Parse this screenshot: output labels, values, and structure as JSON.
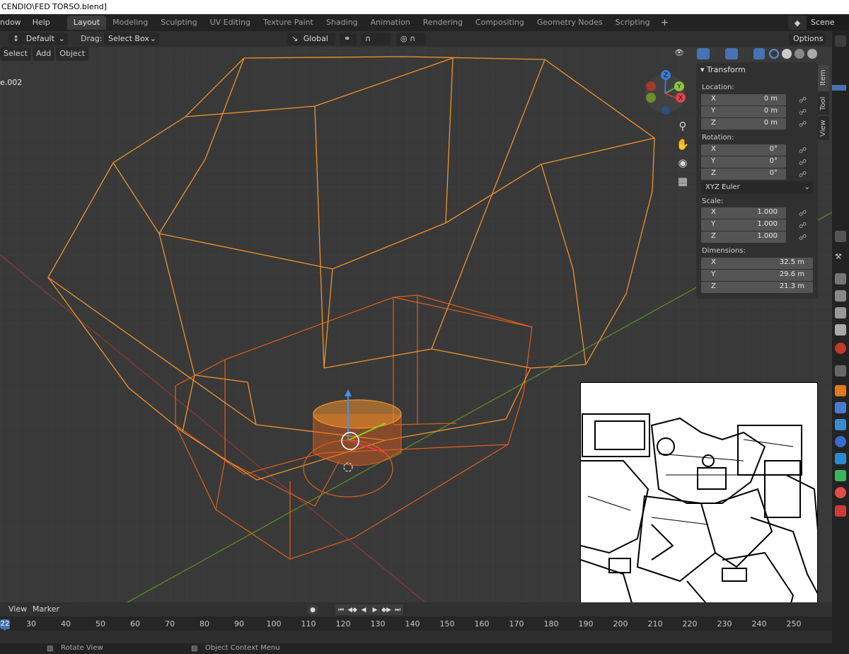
{
  "window": {
    "title": "CENDIO\\FED TORSO.blend]"
  },
  "menubar": {
    "items": [
      "ndow",
      "Help"
    ],
    "tabs": [
      "Layout",
      "Modeling",
      "Sculpting",
      "UV Editing",
      "Texture Paint",
      "Shading",
      "Animation",
      "Rendering",
      "Compositing",
      "Geometry Nodes",
      "Scripting"
    ],
    "add_tab": "+",
    "scene": "Scene"
  },
  "header": {
    "mode": "Default",
    "drag_label": "Drag:",
    "drag_value": "Select Box",
    "orientation": "Global",
    "options": "Options"
  },
  "viewport": {
    "menu": [
      "Select",
      "Add",
      "Object"
    ],
    "object_label": "e.002",
    "gizmo_axes": [
      "Z",
      "Y",
      "X"
    ]
  },
  "npanel": {
    "title": "Transform",
    "location_label": "Location:",
    "location": [
      {
        "axis": "X",
        "value": "0 m"
      },
      {
        "axis": "Y",
        "value": "0 m"
      },
      {
        "axis": "Z",
        "value": "0 m"
      }
    ],
    "rotation_label": "Rotation:",
    "rotation": [
      {
        "axis": "X",
        "value": "0°"
      },
      {
        "axis": "Y",
        "value": "0°"
      },
      {
        "axis": "Z",
        "value": "0°"
      }
    ],
    "rotation_mode": "XYZ Euler",
    "scale_label": "Scale:",
    "scale": [
      {
        "axis": "X",
        "value": "1.000"
      },
      {
        "axis": "Y",
        "value": "1.000"
      },
      {
        "axis": "Z",
        "value": "1.000"
      }
    ],
    "dimensions_label": "Dimensions:",
    "dimensions": [
      {
        "axis": "X",
        "value": "32.5 m"
      },
      {
        "axis": "Y",
        "value": "29.6 m"
      },
      {
        "axis": "Z",
        "value": "21.3 m"
      }
    ],
    "tabs": [
      "Item",
      "Tool",
      "View"
    ]
  },
  "timeline": {
    "menu": [
      "View",
      "Marker"
    ],
    "current_frame": "22",
    "ticks": [
      "30",
      "40",
      "50",
      "60",
      "70",
      "80",
      "90",
      "100",
      "110",
      "120",
      "130",
      "140",
      "150",
      "160",
      "170",
      "180",
      "190",
      "200",
      "210",
      "220",
      "230",
      "240",
      "250"
    ]
  },
  "status": {
    "left": "Rotate View",
    "right": "Object Context Menu"
  },
  "colors": {
    "wire": "#f0922e",
    "wire_inner": "#e0601a",
    "x_axis": "#9a3a3a",
    "y_axis": "#6a8a2a",
    "accent": "#4772b3"
  }
}
